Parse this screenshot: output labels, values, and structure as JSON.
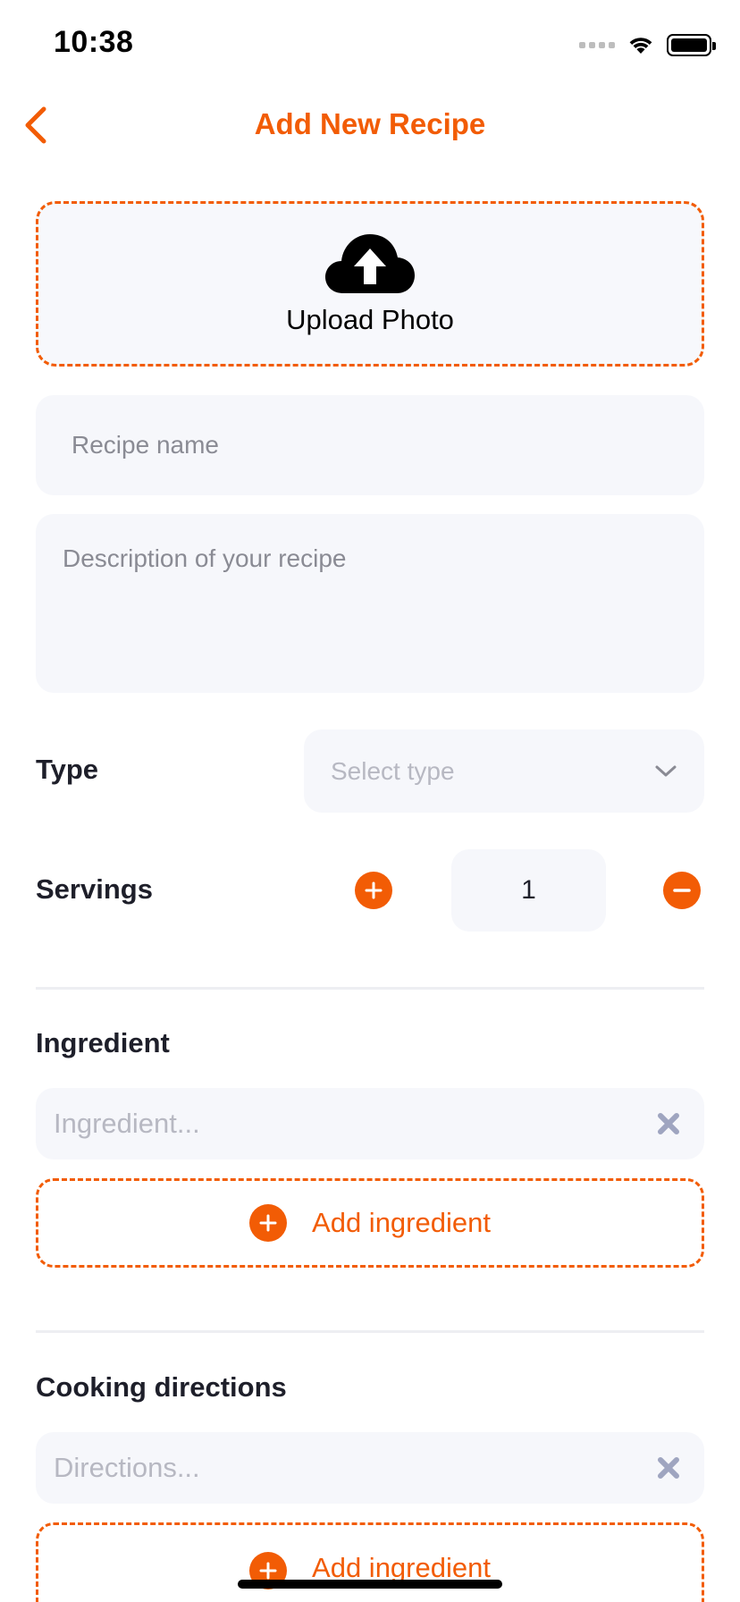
{
  "status_bar": {
    "time": "10:38"
  },
  "nav": {
    "title": "Add New Recipe",
    "back_icon": "chevron-left-icon"
  },
  "upload": {
    "label": "Upload Photo",
    "icon": "cloud-upload-icon"
  },
  "recipe_name": {
    "value": "",
    "placeholder": "Recipe name"
  },
  "description": {
    "value": "",
    "placeholder": "Description of your recipe"
  },
  "type": {
    "label": "Type",
    "placeholder": "Select type",
    "icon": "chevron-down-icon"
  },
  "servings": {
    "label": "Servings",
    "value": "1",
    "plus_icon": "plus-circle-icon",
    "minus_icon": "minus-circle-icon"
  },
  "ingredients": {
    "title": "Ingredient",
    "entry_placeholder": "Ingredient...",
    "clear_icon": "close-icon",
    "add_label": "Add ingredient"
  },
  "directions": {
    "title": "Cooking directions",
    "entry_placeholder": "Directions...",
    "clear_icon": "close-icon",
    "add_label": "Add ingredient"
  },
  "colors": {
    "accent": "#F25C05",
    "field_bg": "#F6F7FB",
    "text_primary": "#1E1F2A",
    "placeholder": "#B7B8C2",
    "clear_icon": "#9FA5C0"
  }
}
